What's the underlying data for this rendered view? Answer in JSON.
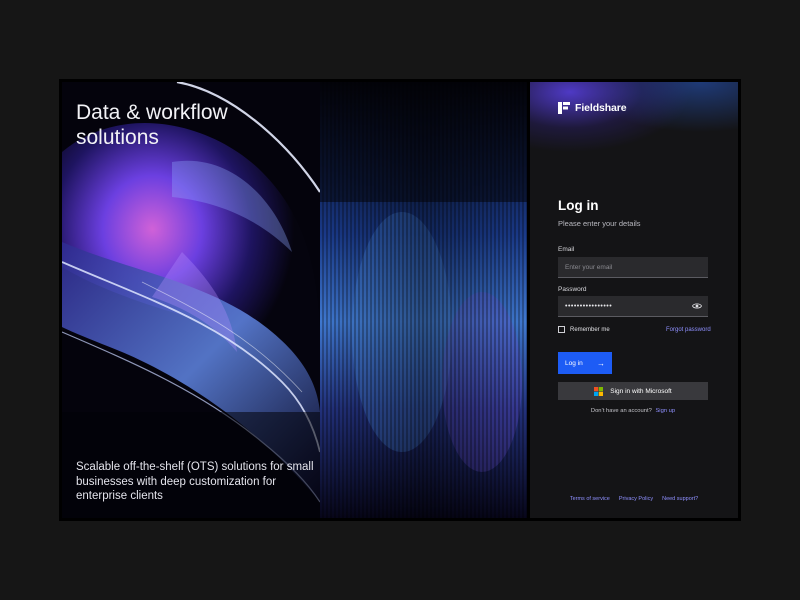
{
  "hero": {
    "title": "Data & workflow solutions",
    "subtitle": "Scalable off-the-shelf (OTS) solutions for small businesses with deep customization for enterprise clients"
  },
  "brand": {
    "name": "Fieldshare",
    "logo_icon": "fieldshare-logo-icon"
  },
  "login": {
    "title": "Log in",
    "subtitle": "Please enter your details",
    "email_label": "Email",
    "email_placeholder": "Enter your email",
    "email_value": "",
    "password_label": "Password",
    "password_value": "••••••••••••••••",
    "show_password_icon": "eye-icon",
    "remember_label": "Remember me",
    "remember_checked": false,
    "forgot_label": "Forgot password",
    "login_button": "Log in",
    "login_button_icon": "arrow-right-icon",
    "microsoft_button": "Sign in with Microsoft",
    "microsoft_icon": "microsoft-logo-icon",
    "no_account_text": "Don’t have an account?",
    "signup_label": "Sign up"
  },
  "footer": {
    "terms": "Terms of service",
    "privacy": "Privacy Policy",
    "support": "Need support?"
  },
  "colors": {
    "page_bg": "#161616",
    "panel_bg": "#141416",
    "input_bg": "#2a2a2d",
    "primary_button": "#1d5cf5",
    "secondary_button": "#39393d",
    "link": "#8f90ff",
    "accent_purple": "#6246ff"
  }
}
